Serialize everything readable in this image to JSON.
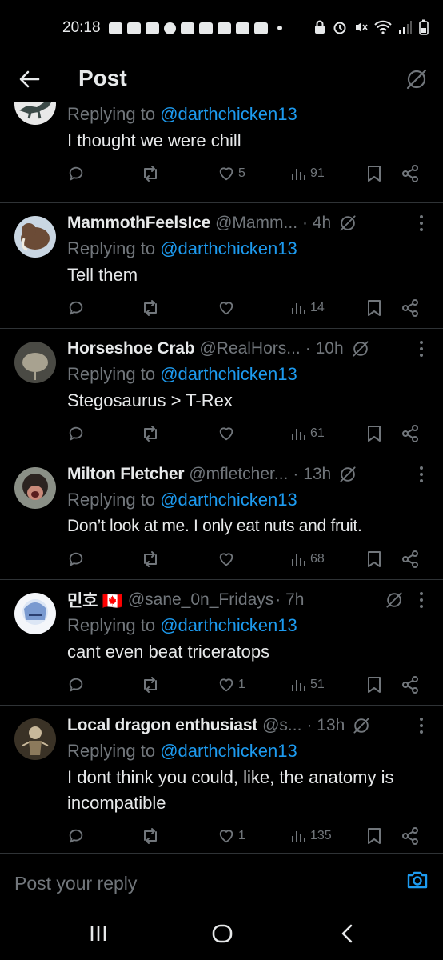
{
  "status_bar": {
    "time": "20:18"
  },
  "header": {
    "title": "Post"
  },
  "posts": [
    {
      "name": "",
      "handle": "",
      "time": "",
      "reply_prefix": "Replying to ",
      "reply_mention": "@darthchicken13",
      "text": "I thought we were chill",
      "likes": "5",
      "views": "91",
      "avatar": "dinosaur"
    },
    {
      "name": "MammothFeelsIce",
      "handle": "@Mamm...",
      "time": "· 4h",
      "reply_prefix": "Replying to ",
      "reply_mention": "@darthchicken13",
      "text": "Tell them",
      "likes": "",
      "views": "14",
      "avatar": "mammoth"
    },
    {
      "name": "Horseshoe Crab",
      "handle": "@RealHors...",
      "time": "· 10h",
      "reply_prefix": "Replying to ",
      "reply_mention": "@darthchicken13",
      "text": "Stegosaurus > T-Rex",
      "likes": "",
      "views": "61",
      "avatar": "crab"
    },
    {
      "name": "Milton Fletcher",
      "handle": "@mfletcher...",
      "time": "· 13h",
      "reply_prefix": "Replying to ",
      "reply_mention": "@darthchicken13",
      "text": "Don’t look at me. I only eat nuts and fruit.",
      "likes": "",
      "views": "68",
      "avatar": "chimp"
    },
    {
      "name": "민호 🇨🇦",
      "handle": "@sane_0n_Fridays",
      "time": "· 7h",
      "reply_prefix": "Replying to ",
      "reply_mention": "@darthchicken13",
      "text": "cant even beat triceratops",
      "likes": "1",
      "views": "51",
      "avatar": "anime"
    },
    {
      "name": "Local dragon enthusiast",
      "handle": "@s...",
      "time": "· 13h",
      "reply_prefix": "Replying to ",
      "reply_mention": "@darthchicken13",
      "text": "I dont think you could, like, the anatomy is incompatible",
      "likes": "1",
      "views": "135",
      "avatar": "skeleton"
    }
  ],
  "reply_bar": {
    "placeholder": "Post your reply"
  },
  "colors": {
    "accent": "#1d9bf0",
    "muted": "#71767b",
    "text": "#e7e9ea",
    "divider": "#2f3336"
  }
}
